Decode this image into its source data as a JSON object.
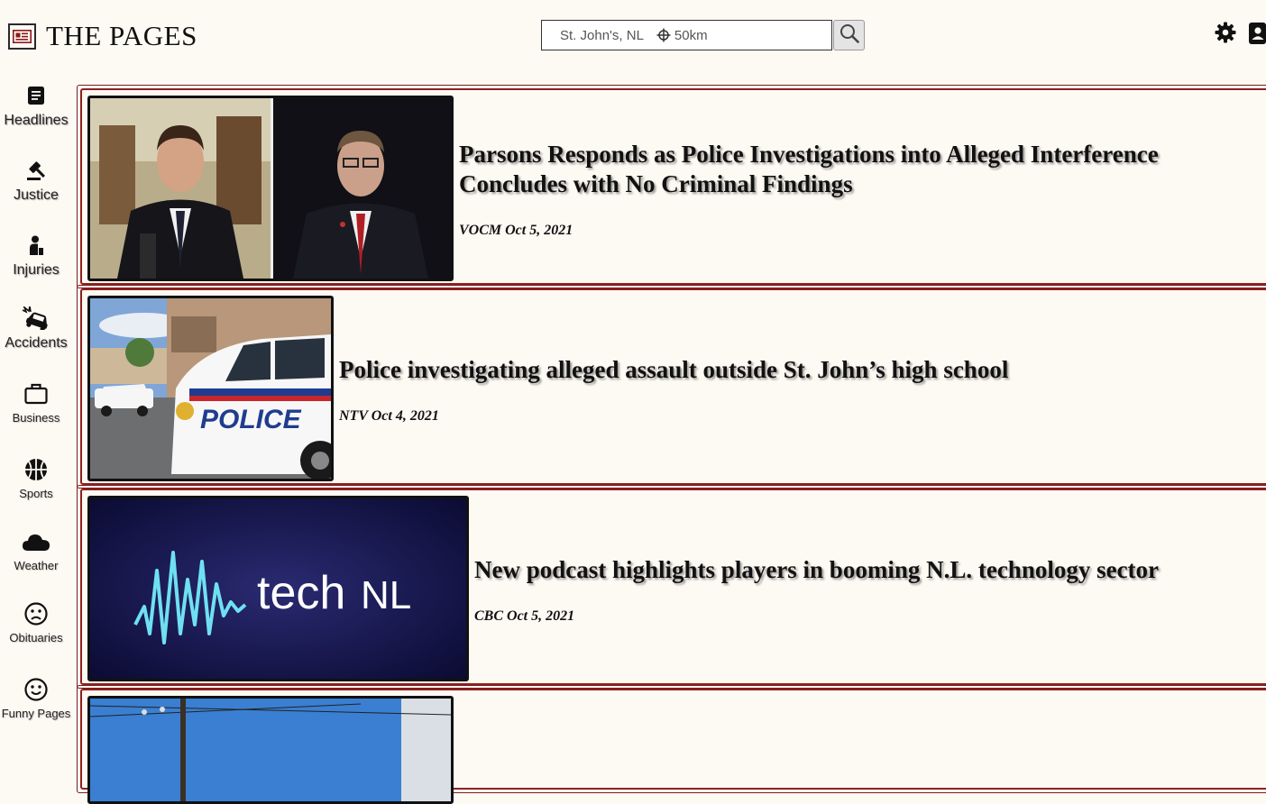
{
  "app": {
    "title": "THE PAGES",
    "logo_icon": "newspaper-icon"
  },
  "search": {
    "location": "St. John's, NL",
    "radius": "50km",
    "radius_icon": "crosshair-icon",
    "button_icon": "search-icon"
  },
  "header_actions": {
    "settings_icon": "gear-icon",
    "profile_icon": "profile-card-icon"
  },
  "sidebar": {
    "items": [
      {
        "label": "Headlines",
        "icon": "document-icon"
      },
      {
        "label": "Justice",
        "icon": "gavel-icon"
      },
      {
        "label": "Injuries",
        "icon": "injured-person-icon"
      },
      {
        "label": "Accidents",
        "icon": "car-crash-icon"
      },
      {
        "label": "Business",
        "icon": "briefcase-icon"
      },
      {
        "label": "Sports",
        "icon": "basketball-icon"
      },
      {
        "label": "Weather",
        "icon": "cloud-icon"
      },
      {
        "label": "Obituaries",
        "icon": "sad-face-icon"
      },
      {
        "label": "Funny Pages",
        "icon": "smiley-face-icon"
      }
    ]
  },
  "articles": [
    {
      "title": "Parsons Responds as Police Investigations into Alleged Interference Concludes with No Criminal Findings",
      "source": "VOCM",
      "date": "Oct 5, 2021",
      "image": "two men in suits side by side"
    },
    {
      "title": "Police investigating alleged assault outside St. John’s high school",
      "source": "NTV",
      "date": "Oct 4, 2021",
      "image": "police cars parked outside school"
    },
    {
      "title": "New podcast highlights players in booming N.L. technology sector",
      "source": "CBC",
      "date": "Oct 5, 2021",
      "image": "techNL logo with waveform",
      "image_text_a": "tech",
      "image_text_b": "NL"
    },
    {
      "title": "",
      "source": "",
      "date": "",
      "image": "blue sky with power lines"
    }
  ]
}
